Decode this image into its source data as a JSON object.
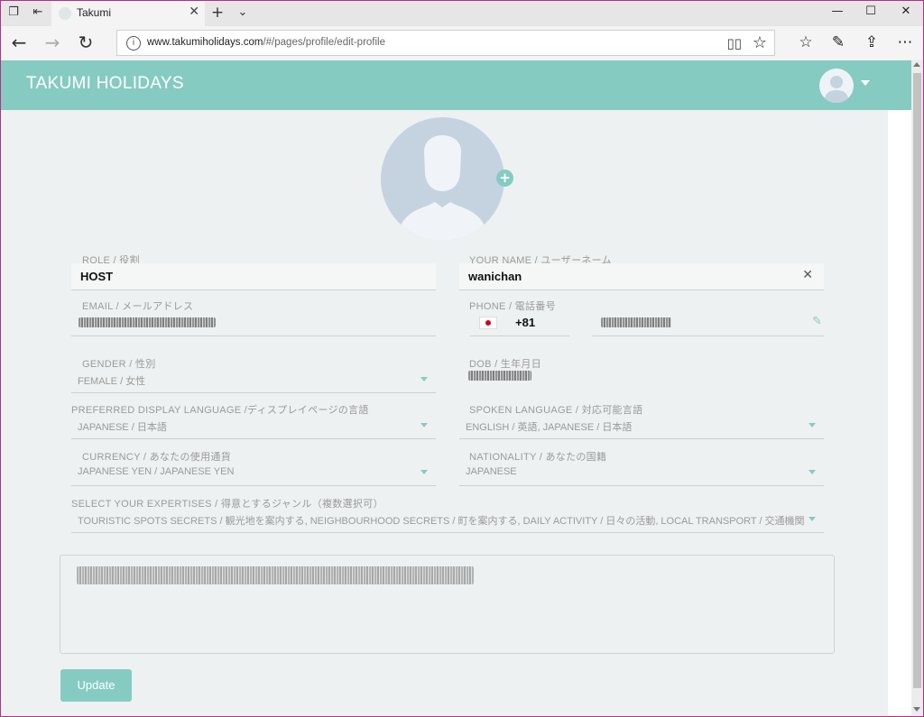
{
  "browser": {
    "tab_title": "Takumi",
    "url_host": "www.takumiholidays.com",
    "url_path": "/#/pages/profile/edit-profile"
  },
  "app": {
    "brand": "TAKUMI HOLIDAYS"
  },
  "form": {
    "role": {
      "label": "ROLE / 役割",
      "value": "HOST"
    },
    "name": {
      "label": "YOUR NAME / ユーザーネーム",
      "value": "wanichan"
    },
    "email": {
      "label": "EMAIL / メールアドレス",
      "value": "[redacted]"
    },
    "phone": {
      "label": "PHONE / 電話番号",
      "country_code": "+81",
      "number": "[redacted]"
    },
    "gender": {
      "label": "GENDER / 性別",
      "value": "FEMALE / 女性"
    },
    "dob": {
      "label": "DOB / 生年月日",
      "value": "[redacted]"
    },
    "display_language": {
      "label": "PREFERRED DISPLAY LANGUAGE /ディスプレイページの言語",
      "value": "JAPANESE / 日本語"
    },
    "spoken_language": {
      "label": "SPOKEN LANGUAGE / 対応可能言語",
      "value": "ENGLISH / 英語, JAPANESE / 日本語"
    },
    "currency": {
      "label": "CURRENCY / あなたの使用通貨",
      "value": "JAPANESE YEN / JAPANESE YEN"
    },
    "nationality": {
      "label": "NATIONALITY / あなたの国籍",
      "value": "JAPANESE"
    },
    "expertises": {
      "label": "SELECT YOUR EXPERTISES / 得意とするジャンル（複数選択可）",
      "value": "TOURISTIC SPOTS SECRETS / 観光地を案内する, NEIGHBOURHOOD SECRETS / 町を案内する, DAILY ACTIVITY / 日々の活動, LOCAL TRANSPORT / 交通機関"
    },
    "bio": {
      "value": "[redacted]"
    },
    "update_label": "Update"
  },
  "colors": {
    "accent": "#86cbc2",
    "background": "#eef1f1"
  },
  "icons": [
    "tabs-icon",
    "back-tabs-icon",
    "new-tab-icon",
    "tab-list-icon",
    "minimize-icon",
    "maximize-icon",
    "close-icon",
    "back-icon",
    "forward-icon",
    "refresh-icon",
    "info-icon",
    "reading-view-icon",
    "favorite-star-icon",
    "favorites-list-icon",
    "notes-icon",
    "share-icon",
    "more-icon",
    "user-avatar-icon",
    "add-photo-icon",
    "clear-icon",
    "edit-pencil-icon",
    "dropdown-caret-icon"
  ]
}
